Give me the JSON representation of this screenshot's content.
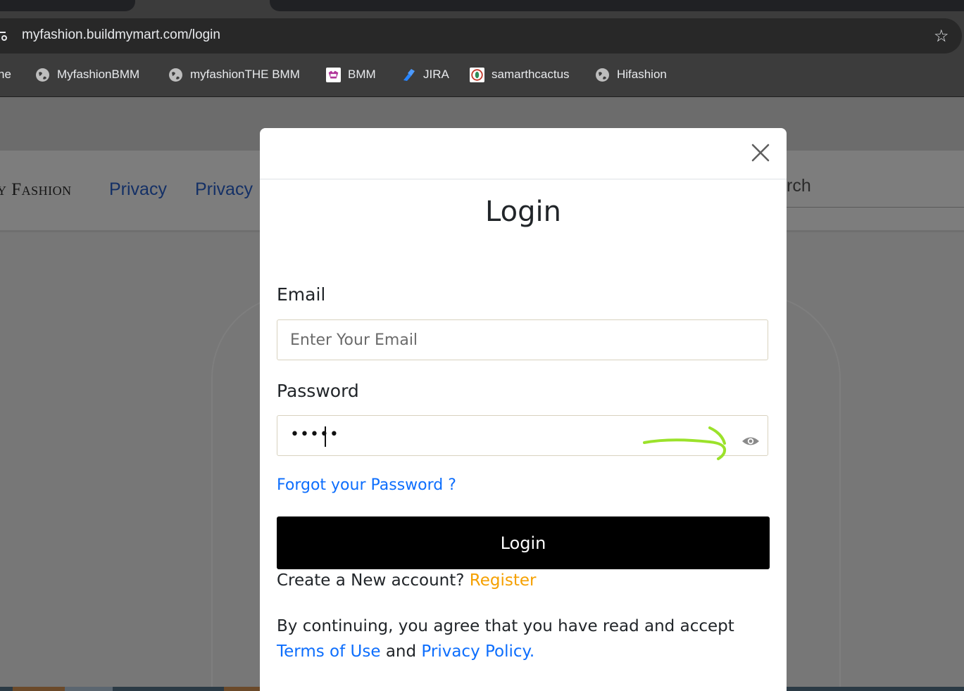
{
  "browser": {
    "url": "myfashion.buildmymart.com/login",
    "bookmarks": [
      {
        "label": "ne",
        "icon": "none"
      },
      {
        "label": "MyfashionBMM",
        "icon": "globe-icon"
      },
      {
        "label": "myfashionTHE BMM",
        "icon": "globe-icon"
      },
      {
        "label": "BMM",
        "icon": "bmm-favicon-icon"
      },
      {
        "label": "JIRA",
        "icon": "jira-icon"
      },
      {
        "label": "samarthcactus",
        "icon": "cactus-favicon-icon"
      },
      {
        "label": "Hifashion",
        "icon": "globe-icon"
      }
    ]
  },
  "site": {
    "brand": "y Fashion",
    "nav_links": [
      "Privacy",
      "Privacy"
    ],
    "search_hint": "rch"
  },
  "modal": {
    "title": "Login",
    "email_label": "Email",
    "email_placeholder": "Enter Your Email",
    "email_value": "",
    "password_label": "Password",
    "password_value": "•••••",
    "forgot_password": "Forgot your Password ?",
    "login_button": "Login",
    "create_account_text": "Create a New account?",
    "register_link": "Register",
    "terms_prefix": "By continuing, you agree that you have read and accept",
    "terms_of_use": "Terms of Use",
    "terms_and": "and",
    "privacy_policy": "Privacy Policy."
  },
  "colors": {
    "link_blue": "#0d6efd",
    "register_orange": "#f5a000",
    "button_black": "#000000",
    "annotation_green": "#9be22b"
  }
}
